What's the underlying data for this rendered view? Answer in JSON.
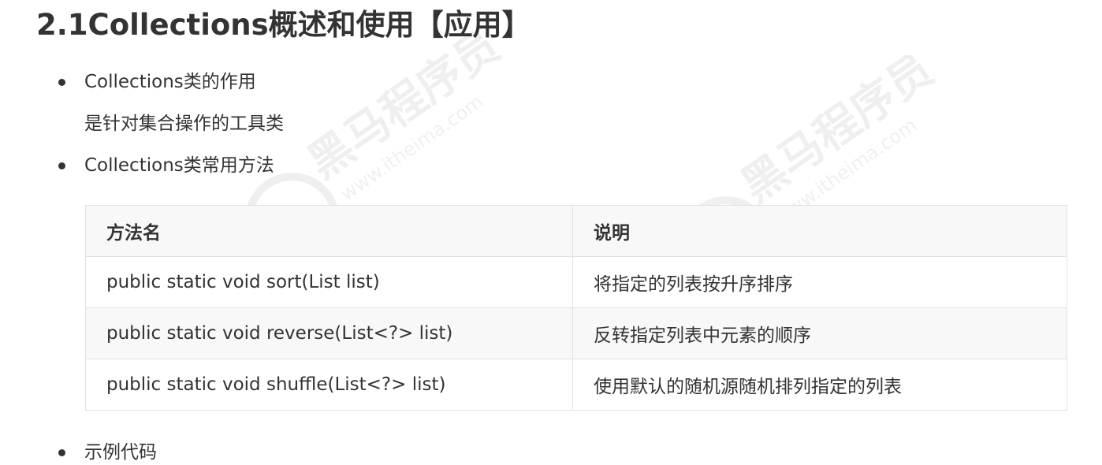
{
  "heading": "2.1Collections概述和使用【应用】",
  "bullets": [
    {
      "text": "Collections类的作用",
      "sub": "是针对集合操作的工具类"
    },
    {
      "text": "Collections类常用方法"
    }
  ],
  "table": {
    "headers": [
      "方法名",
      "说明"
    ],
    "rows": [
      [
        "public static void sort(List list)",
        "将指定的列表按升序排序"
      ],
      [
        "public static void reverse(List<?> list)",
        "反转指定列表中元素的顺序"
      ],
      [
        "public static void shuffle(List<?> list)",
        "使用默认的随机源随机排列指定的列表"
      ]
    ]
  },
  "partial_bullet": "示例代码",
  "watermark": {
    "brand": "黑马程序员",
    "url": "www.itheima.com"
  },
  "colors": {
    "text": "#333333",
    "border": "#dfe2e5",
    "header_bg": "#f8f8f8"
  }
}
